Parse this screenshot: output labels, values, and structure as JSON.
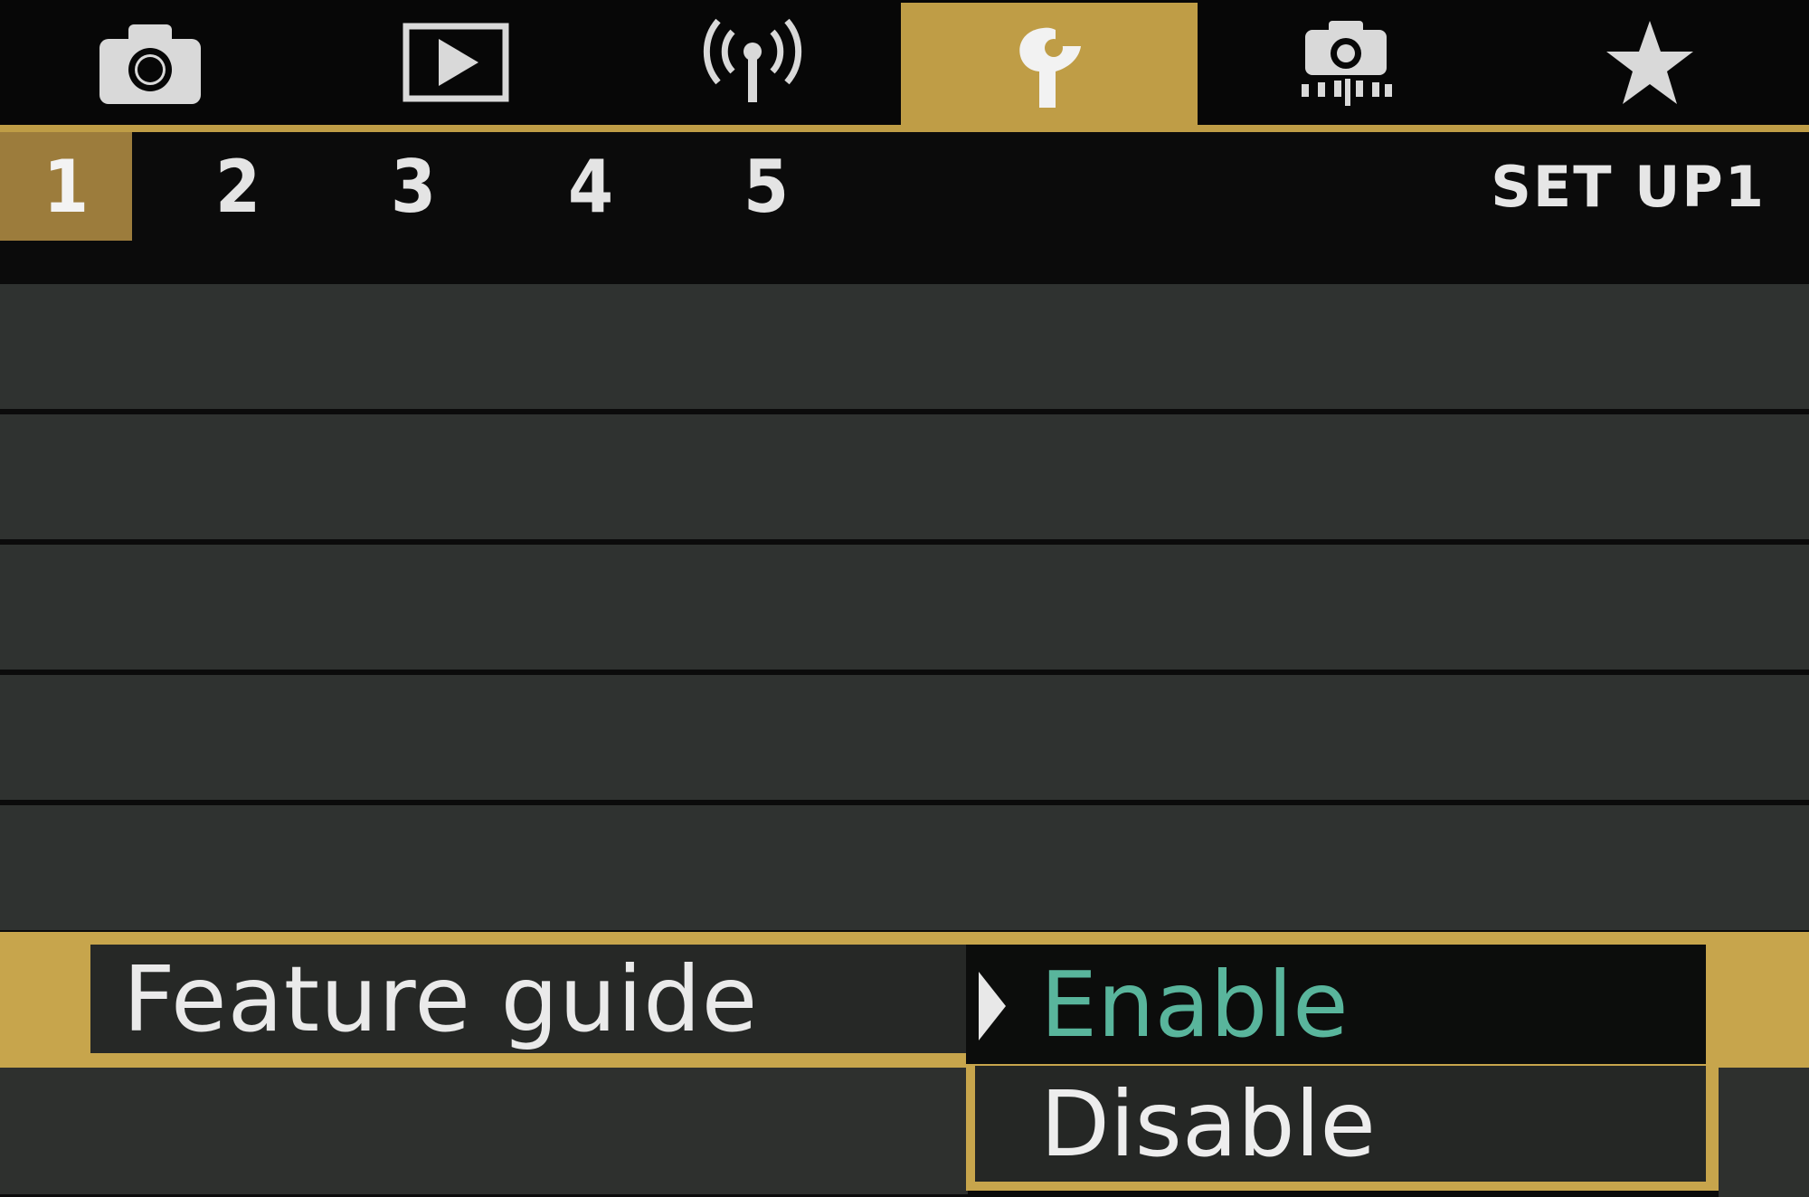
{
  "tabs": [
    {
      "name": "shooting",
      "icon": "camera-icon",
      "active": false
    },
    {
      "name": "playback",
      "icon": "playback-icon",
      "active": false
    },
    {
      "name": "wireless",
      "icon": "wireless-icon",
      "active": false
    },
    {
      "name": "setup",
      "icon": "wrench-icon",
      "active": true
    },
    {
      "name": "custom-function",
      "icon": "camera-settings-icon",
      "active": false
    },
    {
      "name": "my-menu",
      "icon": "star-icon",
      "active": false
    }
  ],
  "subtabs": [
    "1",
    "2",
    "3",
    "4",
    "5"
  ],
  "active_subtab": "1",
  "menu_title": "SET UP1",
  "selected_item": {
    "label": "Feature guide",
    "options": [
      "Enable",
      "Disable"
    ],
    "highlighted_option": "Enable"
  },
  "colors": {
    "accent": "#bf9d46",
    "row": "#2f3230",
    "enable_text": "#59b59c"
  }
}
